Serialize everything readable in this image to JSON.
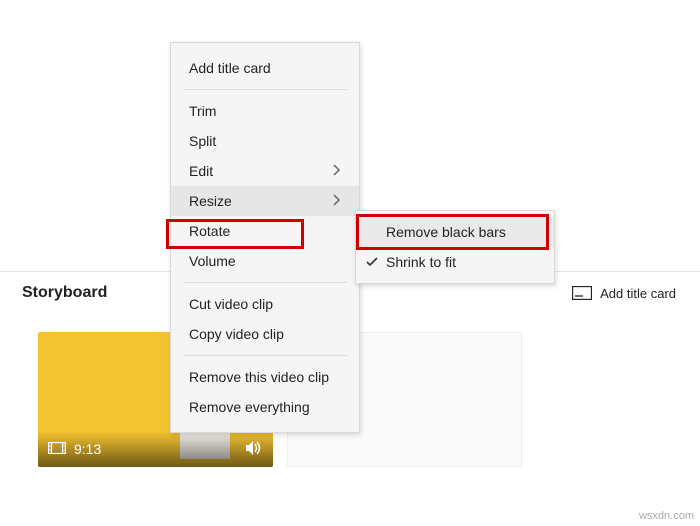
{
  "storyboard": {
    "title": "Storyboard",
    "add_title_card_label": "Add title card"
  },
  "clip": {
    "duration": "9:13"
  },
  "menu": {
    "add_title_card": "Add title card",
    "trim": "Trim",
    "split": "Split",
    "edit": "Edit",
    "resize": "Resize",
    "rotate": "Rotate",
    "volume": "Volume",
    "cut_video_clip": "Cut video clip",
    "copy_video_clip": "Copy video clip",
    "remove_this_video_clip": "Remove this video clip",
    "remove_everything": "Remove everything"
  },
  "submenu": {
    "remove_black_bars": "Remove black bars",
    "shrink_to_fit": "Shrink to fit"
  },
  "watermark": "wsxdn.com"
}
